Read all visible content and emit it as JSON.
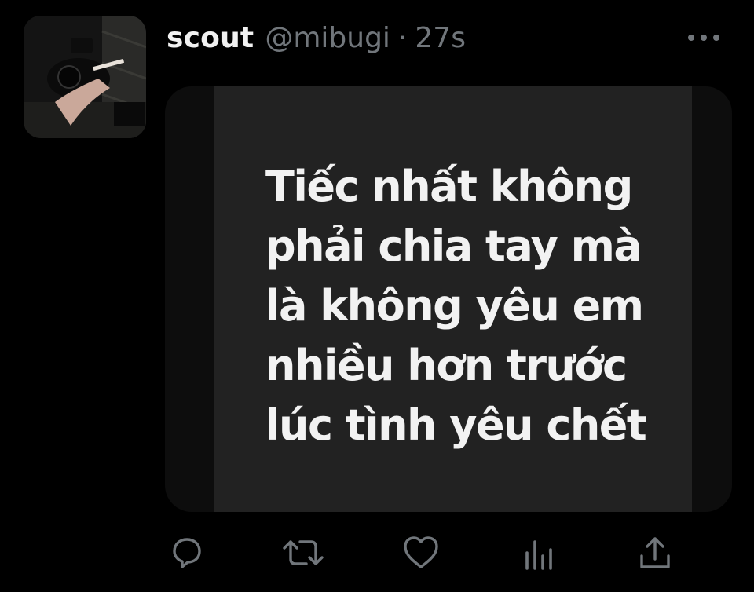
{
  "tweet": {
    "display_name": "scout",
    "handle": "@mibugi",
    "separator": "·",
    "timestamp": "27s",
    "avatar_icon": "avatar-photo-camera",
    "media_text_lines": [
      "Tiếc nhất không",
      "phải chia tay mà",
      "là không yêu em",
      "nhiều hơn trước",
      "lúc tình yêu chết"
    ]
  },
  "actions": [
    {
      "name": "reply",
      "icon": "reply-icon"
    },
    {
      "name": "retweet",
      "icon": "retweet-icon"
    },
    {
      "name": "like",
      "icon": "heart-icon"
    },
    {
      "name": "views",
      "icon": "analytics-icon"
    },
    {
      "name": "share",
      "icon": "share-icon"
    }
  ],
  "colors": {
    "background": "#000000",
    "text_primary": "#f1f1f1",
    "text_secondary": "#71767b",
    "media_panel": "#222222",
    "icon": "#71767b"
  }
}
